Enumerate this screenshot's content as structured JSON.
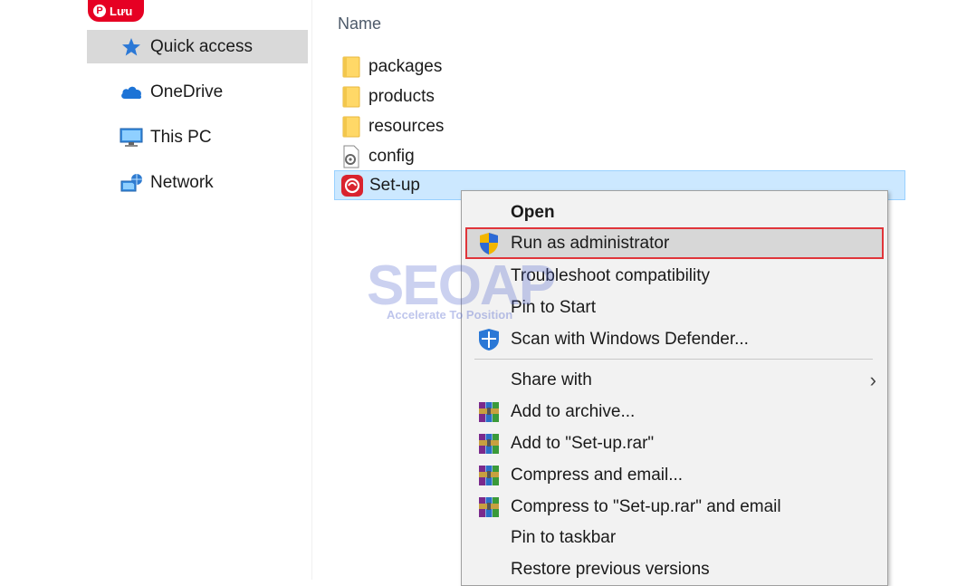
{
  "pin_badge": {
    "label": "Lưu"
  },
  "nav": {
    "items": [
      {
        "label": "Quick access",
        "icon": "star-icon"
      },
      {
        "label": "OneDrive",
        "icon": "cloud-icon"
      },
      {
        "label": "This PC",
        "icon": "monitor-icon"
      },
      {
        "label": "Network",
        "icon": "network-icon"
      }
    ]
  },
  "file_list": {
    "column_header": "Name",
    "files": [
      {
        "name": "packages",
        "icon": "folder-icon"
      },
      {
        "name": "products",
        "icon": "folder-icon"
      },
      {
        "name": "resources",
        "icon": "folder-icon"
      },
      {
        "name": "config",
        "icon": "settings-file-icon"
      },
      {
        "name": "Set-up",
        "icon": "setup-app-icon"
      }
    ]
  },
  "context_menu": {
    "items": [
      {
        "label": "Open"
      },
      {
        "label": "Run as administrator",
        "icon": "uac-shield-icon"
      },
      {
        "label": "Troubleshoot compatibility"
      },
      {
        "label": "Pin to Start"
      },
      {
        "label": "Scan with Windows Defender...",
        "icon": "defender-icon"
      },
      {
        "label": "Share with",
        "submenu_arrow": "›"
      },
      {
        "label": "Add to archive...",
        "icon": "winrar-icon"
      },
      {
        "label": "Add to \"Set-up.rar\"",
        "icon": "winrar-icon"
      },
      {
        "label": "Compress and email...",
        "icon": "winrar-icon"
      },
      {
        "label": "Compress to \"Set-up.rar\" and email",
        "icon": "winrar-icon"
      },
      {
        "label": "Pin to taskbar"
      },
      {
        "label": "Restore previous versions"
      }
    ]
  },
  "watermark": {
    "text": "SEOAP",
    "subtext": "Accelerate To Position"
  },
  "colors": {
    "selection_highlight": "#cce8ff",
    "menu_highlight_border": "#e0353a",
    "folder_yellow": "#ffd867",
    "pinterest_red": "#e60023"
  }
}
